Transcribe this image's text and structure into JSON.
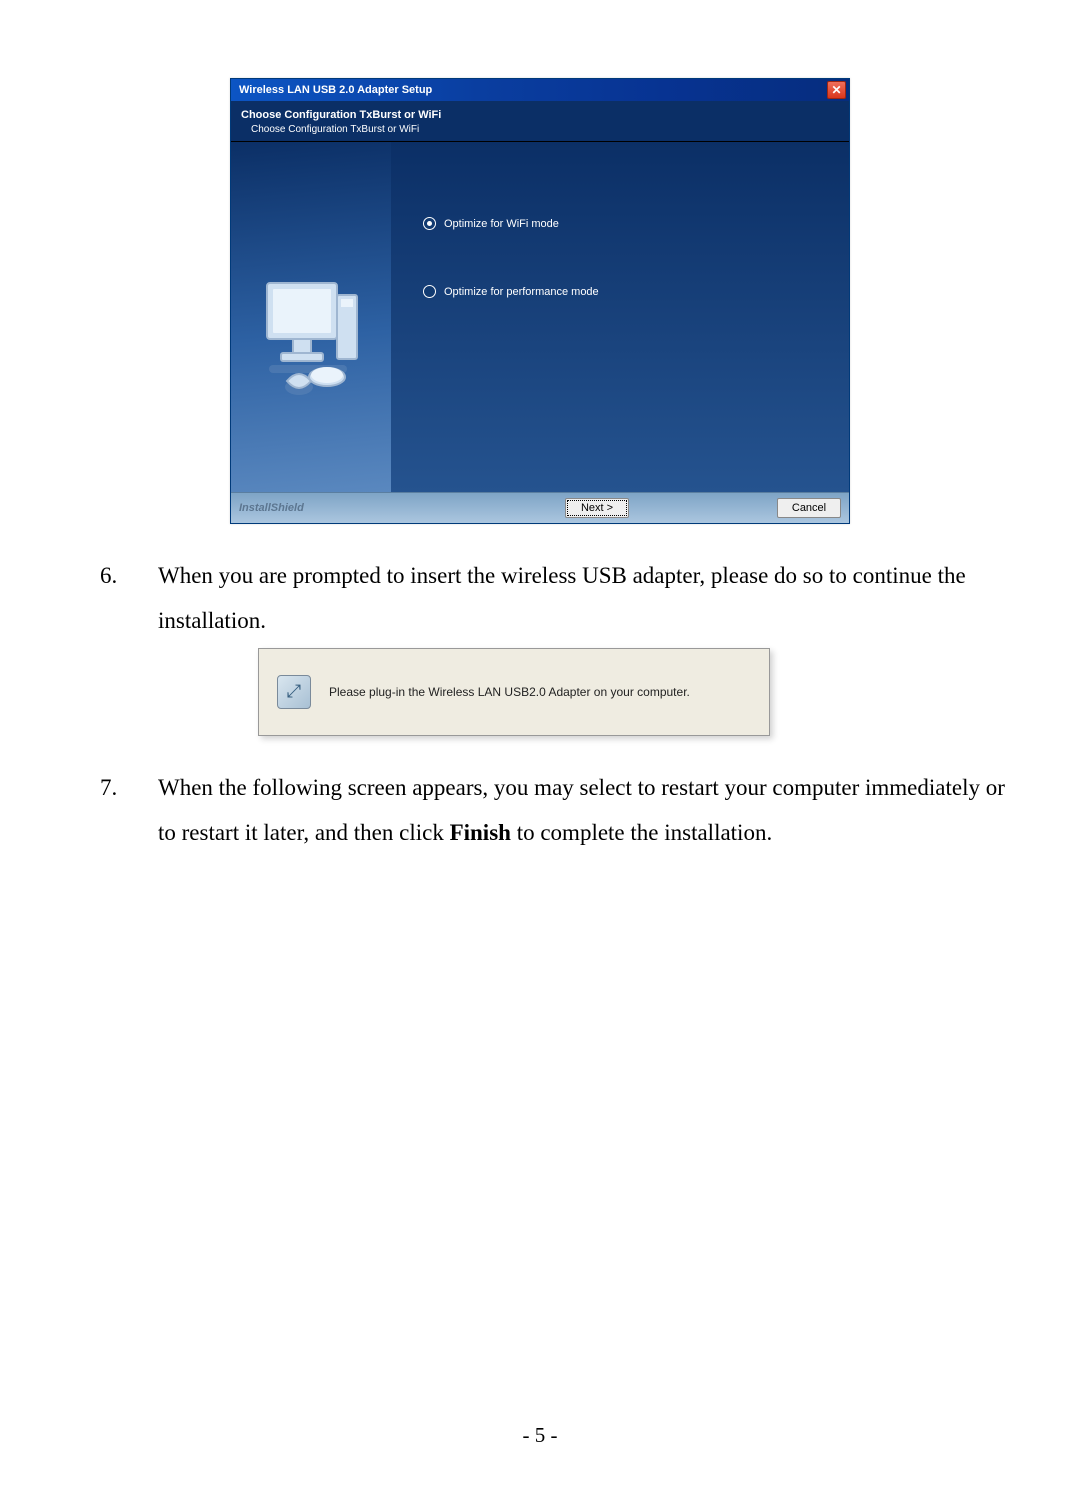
{
  "installer": {
    "title": "Wireless LAN USB 2.0 Adapter Setup",
    "heading": "Choose Configuration TxBurst or WiFi",
    "subheading": "Choose Configuration TxBurst or WiFi",
    "options": {
      "opt1": "Optimize for WiFi mode",
      "opt2": "Optimize for performance mode",
      "selected": "opt1"
    },
    "brand": "InstallShield",
    "next_label": "Next >",
    "cancel_label": "Cancel",
    "close_glyph": "✕"
  },
  "steps": {
    "s6": {
      "num": "6.",
      "text": "When you are prompted to insert the wireless USB adapter, please do so to continue the installation."
    },
    "s7": {
      "num": "7.",
      "prefix": "When the following screen appears, you may select to restart your computer immediately or to restart it later, and then click ",
      "bold": "Finish",
      "suffix": " to complete the installation."
    }
  },
  "prompt": {
    "text": "Please plug-in the Wireless LAN USB2.0 Adapter on your computer.",
    "icon_glyph": "⤢"
  },
  "page_number": "- 5 -"
}
